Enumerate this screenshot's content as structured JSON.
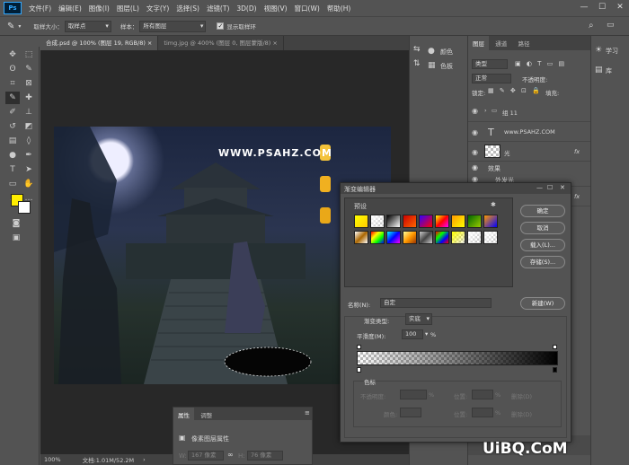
{
  "menubar": {
    "logo": "Ps",
    "items": [
      "文件(F)",
      "编辑(E)",
      "图像(I)",
      "图层(L)",
      "文字(Y)",
      "选择(S)",
      "滤镜(T)",
      "3D(D)",
      "视图(V)",
      "窗口(W)",
      "帮助(H)"
    ],
    "minimize": "—",
    "maximize": "☐",
    "close": "✕"
  },
  "options": {
    "sample_size_label": "取样大小：",
    "sample_size_value": "取样点",
    "sample_label": "样本：",
    "sample_value": "所有图层",
    "show_ring_label": "显示取样环"
  },
  "tabs": [
    {
      "label": "合成.psd @ 100% (图层 19, RGB/8) ×"
    },
    {
      "label": "timg.jpg @ 400% (图层 0, 图层蒙版/8) ×"
    }
  ],
  "document": {
    "title_text": "WWW.PSAHZ.COM"
  },
  "status": {
    "zoom": "100%",
    "doc_info": "文档:1.01M/52.2M"
  },
  "icon_panel": {
    "items": [
      {
        "icon": "palette-icon",
        "label": "颜色"
      },
      {
        "icon": "swatches-icon",
        "label": "色板"
      }
    ]
  },
  "layers_panel": {
    "tabs": [
      "图层",
      "通道",
      "路径"
    ],
    "filter_placeholder": "类型",
    "blend_mode": "正常",
    "opacity_label": "不透明度:",
    "lock_label": "锁定:",
    "fill_label": "填充:",
    "rows": [
      {
        "name": "组 11",
        "type": "group"
      },
      {
        "name": "www.PSAHZ.COM",
        "type": "text"
      },
      {
        "name": "光",
        "type": "layer",
        "fx": "fx"
      },
      {
        "name": "效果",
        "type": "sub"
      },
      {
        "name": "外发光",
        "type": "sub"
      },
      {
        "name": "光",
        "type": "layer",
        "fx": "fx"
      }
    ]
  },
  "learn_panel": {
    "items": [
      {
        "icon": "bulb-icon",
        "label": "学习"
      },
      {
        "icon": "library-icon",
        "label": "库"
      }
    ]
  },
  "properties_panel": {
    "tabs": [
      "属性",
      "调整"
    ],
    "item_label": "像素图层属性",
    "w_label": "W:",
    "w_value": "167 像素",
    "h_label": "H:",
    "h_value": "76 像素"
  },
  "gradient_editor": {
    "title": "渐变编辑器",
    "presets_label": "预设",
    "gear": "✱",
    "buttons": {
      "ok": "确定",
      "cancel": "取消",
      "load": "载入(L)...",
      "save": "存储(S)...",
      "new": "新建(W)",
      "minimize": "—",
      "maximize": "☐",
      "close": "✕"
    },
    "name_label": "名称(N):",
    "name_value": "自定",
    "type_label": "渐变类型:",
    "type_value": "实底",
    "smooth_label": "平滑度(M):",
    "smooth_value": "100",
    "smooth_unit": "%",
    "stops_group_label": "色标",
    "opacity_label": "不透明度:",
    "opacity_unit": "%",
    "location_label": "位置:",
    "location_unit": "%",
    "delete_label": "删除(D)",
    "color_label": "颜色:",
    "presets": [
      {
        "colors": [
          "#ffff00",
          "#ffcc00"
        ]
      },
      {
        "colors": [
          "#ffffff",
          "#888888"
        ],
        "checker": true
      },
      {
        "colors": [
          "#000000",
          "#ffffff"
        ]
      },
      {
        "colors": [
          "#cc0000",
          "#ff6600"
        ]
      },
      {
        "colors": [
          "#3300ff",
          "#ff0000"
        ]
      },
      {
        "colors": [
          "#ffff00",
          "#ff0000",
          "#ff00ff"
        ]
      },
      {
        "colors": [
          "#ff9900",
          "#ffff00"
        ]
      },
      {
        "colors": [
          "#006600",
          "#99cc00"
        ]
      },
      {
        "colors": [
          "#ff9900",
          "#0000ff"
        ]
      },
      {
        "colors": [
          "#ffffff",
          "#aa6600",
          "#ffffff"
        ]
      },
      {
        "colors": [
          "#ff0000",
          "#ffff00",
          "#00ff00",
          "#0000ff"
        ]
      },
      {
        "colors": [
          "#00ffff",
          "#0000ff",
          "#ff00ff"
        ]
      },
      {
        "colors": [
          "#ffff99",
          "#ff9900",
          "#993300"
        ]
      },
      {
        "colors": [
          "#cccccc",
          "#444444",
          "#cccccc"
        ]
      },
      {
        "colors": [
          "#ff0000",
          "#00ff00",
          "#0000ff",
          "#ff0000"
        ]
      },
      {
        "colors": [
          "#ffff00",
          "#ffffff"
        ],
        "checker": true
      },
      {
        "colors": [
          "#ffffff",
          "#dddddd"
        ],
        "checker": true
      },
      {
        "colors": [
          "#ffffff",
          "#bbbbbb"
        ],
        "checker": true
      }
    ]
  },
  "watermark": "UiBQ.CoM",
  "colors": {
    "foreground": "#ffee00",
    "background": "#ffffff",
    "accent": "#31a8ff"
  }
}
